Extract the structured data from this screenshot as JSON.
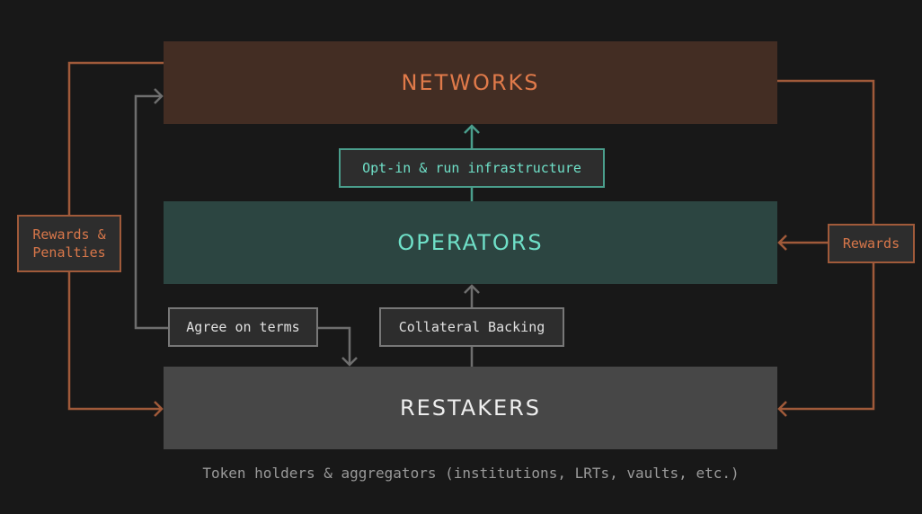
{
  "nodes": {
    "networks": "NETWORKS",
    "operators": "OPERATORS",
    "restakers": "RESTAKERS"
  },
  "edges": {
    "opt_in": "Opt-in & run infrastructure",
    "collateral": "Collateral Backing",
    "agree": "Agree on terms",
    "rewards_penalties": "Rewards &\nPenalties",
    "rewards": "Rewards"
  },
  "caption": "Token holders & aggregators (institutions, LRTs, vaults, etc.)",
  "colors": {
    "background": "#181818",
    "networks_fill": "#432d23",
    "networks_text": "#e07a4a",
    "operators_fill": "#2c4541",
    "operators_text": "#6fe0c8",
    "restakers_fill": "#474747",
    "restakers_text": "#eeeeee",
    "orange_line": "#a05a3a",
    "teal_line": "#4a9e8c",
    "gray_line": "#6e6e6e"
  }
}
